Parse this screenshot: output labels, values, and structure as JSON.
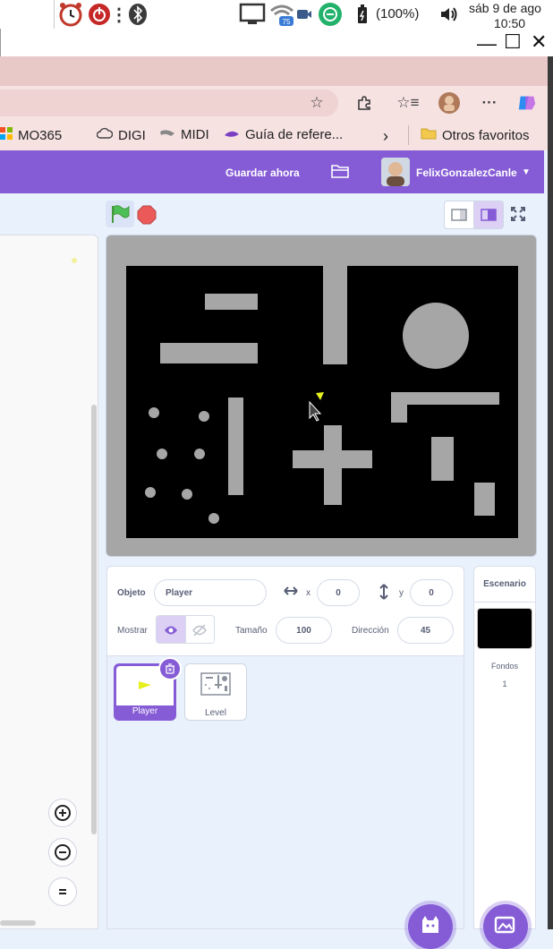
{
  "system_bar": {
    "battery_text": "(100%)",
    "date": "sáb 9 de ago",
    "time": "10:50",
    "wifi_badge": "75"
  },
  "window_controls": {
    "minimize": "—",
    "maximize": "☐",
    "close": "✕"
  },
  "bookmarks": [
    {
      "label": "MO365",
      "icon": "microsoft-icon"
    },
    {
      "label": "DIGI",
      "icon": "cloud-icon"
    },
    {
      "label": "MIDI",
      "icon": "midi-icon"
    },
    {
      "label": "Guía de refere...",
      "icon": "guide-icon"
    },
    {
      "label": "Otros favoritos",
      "icon": "folder-icon"
    }
  ],
  "header": {
    "save_label": "Guardar ahora",
    "username": "FelixGonzalezCanle"
  },
  "sprite_info": {
    "sprite_label": "Objeto",
    "sprite_name": "Player",
    "x_label": "x",
    "x_value": "0",
    "y_label": "y",
    "y_value": "0",
    "show_label": "Mostrar",
    "size_label": "Tamaño",
    "size_value": "100",
    "direction_label": "Dirección",
    "direction_value": "45"
  },
  "sprites": [
    {
      "name": "Player",
      "selected": true
    },
    {
      "name": "Level",
      "selected": false
    }
  ],
  "stage_panel": {
    "title": "Escenario",
    "backdrops_label": "Fondos",
    "backdrops_count": "1"
  },
  "colors": {
    "accent": "#855cd6",
    "stage_obstacle": "#a6a6a6",
    "stage_background": "#000000",
    "player": "#e6f01e"
  }
}
